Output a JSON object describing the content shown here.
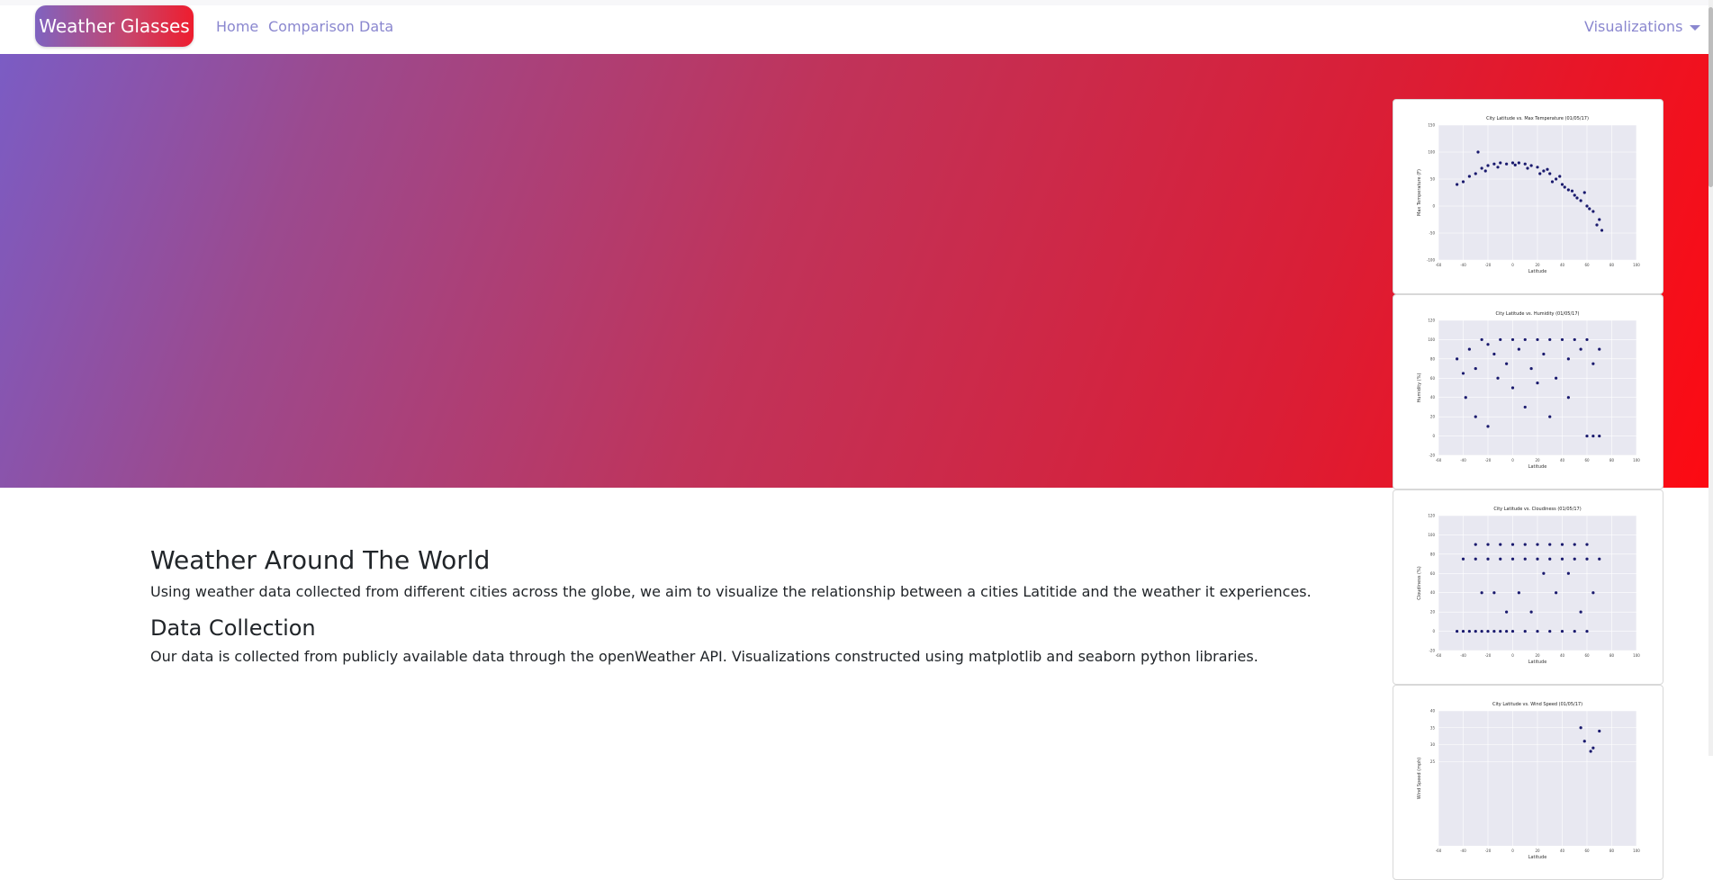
{
  "nav": {
    "brand": "Weather Glasses",
    "links": [
      "Home",
      "Comparison",
      "Data"
    ],
    "dropdown": "Visualizations"
  },
  "main": {
    "heading": "Weather Around The World",
    "intro": "Using weather data collected from different cities across the globe, we aim to visualize the relationship between a cities Latitide and the weather it experiences.",
    "subheading": "Data Collection",
    "collection_text": "Our data is collected from publicly available data through the openWeather API. Visualizations constructed using matplotlib and seaborn python libraries."
  },
  "colors": {
    "accent": "#8a87cf",
    "point": "#1a1a6e",
    "plot_bg": "#e8e8f1"
  },
  "chart_data": [
    {
      "type": "scatter",
      "title": "City Latitude vs. Max Temperature (01/05/17)",
      "xlabel": "Latitude",
      "ylabel": "Max Temperature (F)",
      "xlim": [
        -60,
        100
      ],
      "ylim": [
        -100,
        150
      ],
      "xticks": [
        "-60",
        "-40",
        "-20",
        "0",
        "20",
        "40",
        "60",
        "80",
        "100"
      ],
      "yticks": [
        "150",
        "100",
        "50",
        "0",
        "-50",
        "-100"
      ],
      "grid": true,
      "points": [
        [
          -40,
          45
        ],
        [
          -35,
          55
        ],
        [
          -30,
          60
        ],
        [
          -25,
          70
        ],
        [
          -20,
          75
        ],
        [
          -15,
          78
        ],
        [
          -10,
          80
        ],
        [
          -5,
          78
        ],
        [
          0,
          80
        ],
        [
          5,
          80
        ],
        [
          10,
          78
        ],
        [
          15,
          75
        ],
        [
          20,
          72
        ],
        [
          25,
          65
        ],
        [
          30,
          60
        ],
        [
          35,
          50
        ],
        [
          40,
          40
        ],
        [
          45,
          30
        ],
        [
          50,
          20
        ],
        [
          55,
          10
        ],
        [
          60,
          0
        ],
        [
          65,
          -10
        ],
        [
          70,
          -25
        ],
        [
          -45,
          40
        ],
        [
          -28,
          100
        ],
        [
          -22,
          65
        ],
        [
          -12,
          72
        ],
        [
          2,
          76
        ],
        [
          12,
          70
        ],
        [
          22,
          60
        ],
        [
          32,
          45
        ],
        [
          42,
          35
        ],
        [
          52,
          15
        ],
        [
          62,
          -5
        ],
        [
          68,
          -35
        ],
        [
          72,
          -45
        ],
        [
          58,
          25
        ],
        [
          48,
          28
        ],
        [
          38,
          55
        ],
        [
          28,
          68
        ]
      ]
    },
    {
      "type": "scatter",
      "title": "City Latitude vs. Humidity (01/05/17)",
      "xlabel": "Latitude",
      "ylabel": "Humidity (%)",
      "xlim": [
        -60,
        100
      ],
      "ylim": [
        -20,
        120
      ],
      "xticks": [
        "-60",
        "-40",
        "-20",
        "0",
        "20",
        "40",
        "60",
        "80",
        "100"
      ],
      "yticks": [
        "120",
        "100",
        "80",
        "60",
        "40",
        "20",
        "0",
        "-20"
      ],
      "grid": true,
      "points": [
        [
          -45,
          80
        ],
        [
          -40,
          65
        ],
        [
          -35,
          90
        ],
        [
          -30,
          70
        ],
        [
          -25,
          100
        ],
        [
          -20,
          95
        ],
        [
          -15,
          85
        ],
        [
          -10,
          100
        ],
        [
          -5,
          75
        ],
        [
          0,
          100
        ],
        [
          5,
          90
        ],
        [
          10,
          100
        ],
        [
          15,
          70
        ],
        [
          20,
          100
        ],
        [
          25,
          85
        ],
        [
          30,
          100
        ],
        [
          35,
          60
        ],
        [
          40,
          100
        ],
        [
          45,
          80
        ],
        [
          50,
          100
        ],
        [
          55,
          90
        ],
        [
          60,
          100
        ],
        [
          65,
          75
        ],
        [
          70,
          90
        ],
        [
          -30,
          20
        ],
        [
          -20,
          10
        ],
        [
          10,
          30
        ],
        [
          30,
          20
        ],
        [
          60,
          0
        ],
        [
          65,
          0
        ],
        [
          70,
          0
        ],
        [
          -38,
          40
        ],
        [
          0,
          50
        ],
        [
          20,
          55
        ],
        [
          45,
          40
        ],
        [
          -12,
          60
        ]
      ]
    },
    {
      "type": "scatter",
      "title": "City Latitude vs. Cloudiness (01/05/17)",
      "xlabel": "Latitude",
      "ylabel": "Cloudiness (%)",
      "xlim": [
        -60,
        100
      ],
      "ylim": [
        -20,
        120
      ],
      "xticks": [
        "-60",
        "-40",
        "-20",
        "0",
        "20",
        "40",
        "60",
        "80",
        "100"
      ],
      "yticks": [
        "120",
        "100",
        "80",
        "60",
        "40",
        "20",
        "0",
        "-20"
      ],
      "grid": true,
      "points": [
        [
          -45,
          0
        ],
        [
          -40,
          0
        ],
        [
          -35,
          0
        ],
        [
          -30,
          0
        ],
        [
          -25,
          0
        ],
        [
          -20,
          0
        ],
        [
          -15,
          0
        ],
        [
          -10,
          0
        ],
        [
          -5,
          0
        ],
        [
          0,
          0
        ],
        [
          10,
          0
        ],
        [
          20,
          0
        ],
        [
          30,
          0
        ],
        [
          40,
          0
        ],
        [
          50,
          0
        ],
        [
          60,
          0
        ],
        [
          -40,
          75
        ],
        [
          -30,
          75
        ],
        [
          -20,
          75
        ],
        [
          -10,
          75
        ],
        [
          0,
          75
        ],
        [
          10,
          75
        ],
        [
          20,
          75
        ],
        [
          30,
          75
        ],
        [
          40,
          75
        ],
        [
          50,
          75
        ],
        [
          60,
          75
        ],
        [
          70,
          75
        ],
        [
          -30,
          90
        ],
        [
          -20,
          90
        ],
        [
          -10,
          90
        ],
        [
          0,
          90
        ],
        [
          10,
          90
        ],
        [
          20,
          90
        ],
        [
          30,
          90
        ],
        [
          40,
          90
        ],
        [
          50,
          90
        ],
        [
          60,
          90
        ],
        [
          -25,
          40
        ],
        [
          -15,
          40
        ],
        [
          -5,
          20
        ],
        [
          5,
          40
        ],
        [
          15,
          20
        ],
        [
          25,
          60
        ],
        [
          35,
          40
        ],
        [
          45,
          60
        ],
        [
          55,
          20
        ],
        [
          65,
          40
        ]
      ]
    },
    {
      "type": "scatter",
      "title": "City Latitude vs. Wind Speed (01/05/17)",
      "xlabel": "Latitude",
      "ylabel": "Wind Speed (mph)",
      "xlim": [
        -60,
        100
      ],
      "ylim": [
        0,
        40
      ],
      "xticks": [
        "-60",
        "-40",
        "-20",
        "0",
        "20",
        "40",
        "60",
        "80",
        "100"
      ],
      "yticks": [
        "40",
        "35",
        "30",
        "25"
      ],
      "grid": true,
      "points": [
        [
          55,
          35
        ],
        [
          70,
          34
        ],
        [
          58,
          31
        ],
        [
          65,
          29
        ],
        [
          63,
          28
        ]
      ]
    }
  ]
}
